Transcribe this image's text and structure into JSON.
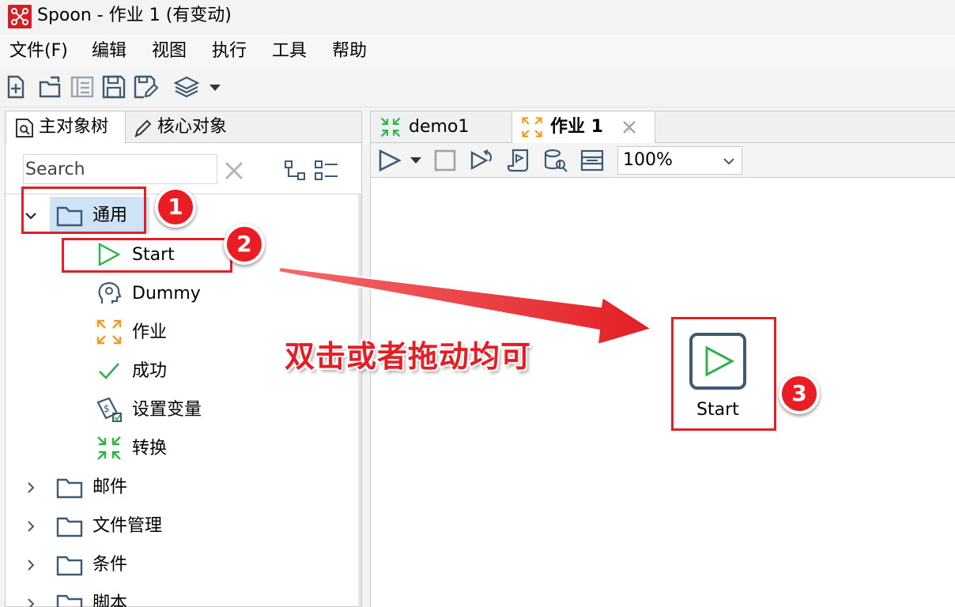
{
  "window": {
    "title": "Spoon - 作业 1 (有变动)"
  },
  "menu": [
    "文件(F)",
    "编辑",
    "视图",
    "执行",
    "工具",
    "帮助"
  ],
  "left_panel": {
    "tabs": [
      "主对象树",
      "核心对象"
    ],
    "search_placeholder": "Search",
    "tree": {
      "general": {
        "label": "通用",
        "children": [
          "Start",
          "Dummy",
          "作业",
          "成功",
          "设置变量",
          "转换"
        ]
      },
      "folders": [
        "邮件",
        "文件管理",
        "条件",
        "脚本"
      ]
    }
  },
  "right_panel": {
    "tabs": [
      "demo1",
      "作业 1"
    ],
    "zoom": "100%",
    "canvas_node_label": "Start"
  },
  "annotations": {
    "badges": [
      "1",
      "2",
      "3"
    ],
    "text": "双击或者拖动均可"
  },
  "colors": {
    "annotation_red": "#e21f26",
    "selection_blue": "#cfe3f7",
    "start_green": "#2db34a",
    "node_border": "#3d5a72"
  }
}
